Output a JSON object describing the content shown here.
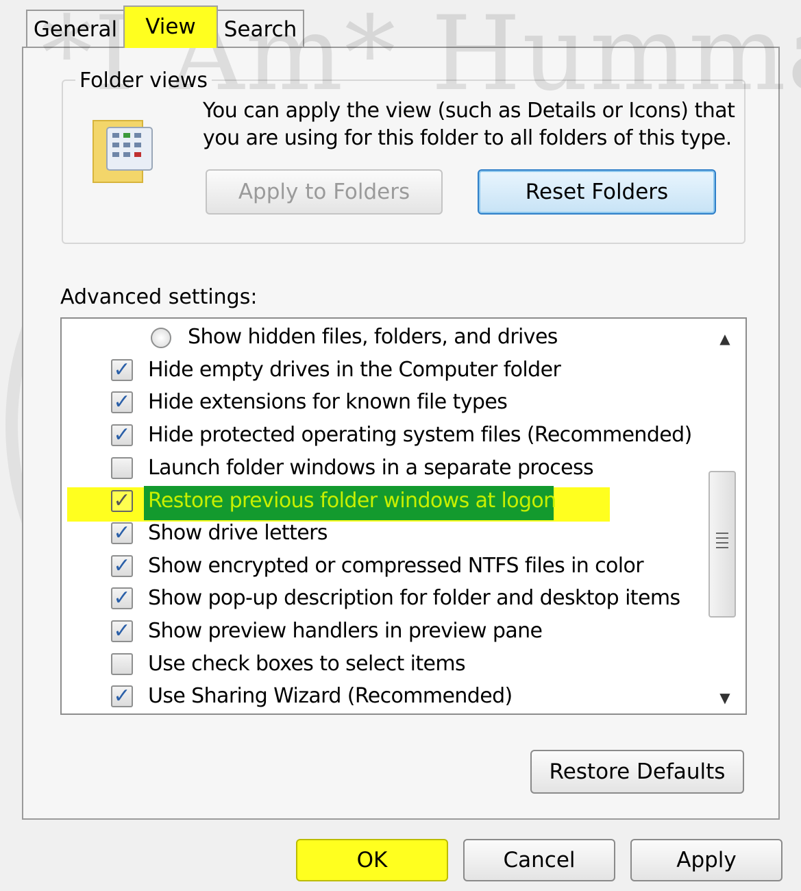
{
  "tabs": {
    "general": "General",
    "view": "View",
    "search": "Search"
  },
  "folder_views": {
    "title": "Folder views",
    "description": "You can apply the view (such as Details or Icons) that you are using for this folder to all folders of this type.",
    "apply_button": "Apply to Folders",
    "reset_button": "Reset Folders",
    "icon": "folder-icon"
  },
  "advanced": {
    "label": "Advanced settings:",
    "items": [
      {
        "label": "Show hidden files, folders, and drives",
        "type": "radio",
        "checked": false
      },
      {
        "label": "Hide empty drives in the Computer folder",
        "type": "checkbox",
        "checked": true
      },
      {
        "label": "Hide extensions for known file types",
        "type": "checkbox",
        "checked": true
      },
      {
        "label": "Hide protected operating system files (Recommended)",
        "type": "checkbox",
        "checked": true
      },
      {
        "label": "Launch folder windows in a separate process",
        "type": "checkbox",
        "checked": false
      },
      {
        "label": "Restore previous folder windows at logon",
        "type": "checkbox",
        "checked": true,
        "selected": true
      },
      {
        "label": "Show drive letters",
        "type": "checkbox",
        "checked": true
      },
      {
        "label": "Show encrypted or compressed NTFS files in color",
        "type": "checkbox",
        "checked": true
      },
      {
        "label": "Show pop-up description for folder and desktop items",
        "type": "checkbox",
        "checked": true
      },
      {
        "label": "Show preview handlers in preview pane",
        "type": "checkbox",
        "checked": true
      },
      {
        "label": "Use check boxes to select items",
        "type": "checkbox",
        "checked": false
      },
      {
        "label": "Use Sharing Wizard (Recommended)",
        "type": "checkbox",
        "checked": true
      }
    ]
  },
  "restore_defaults": "Restore Defaults",
  "footer": {
    "ok": "OK",
    "cancel": "Cancel",
    "apply": "Apply"
  },
  "colors": {
    "highlight_yellow": "#ffff1f",
    "selection_green": "#139a2e",
    "selected_text": "#c7f000",
    "check_blue": "#2a5fa8"
  },
  "watermark": "*I Am* Hummad"
}
